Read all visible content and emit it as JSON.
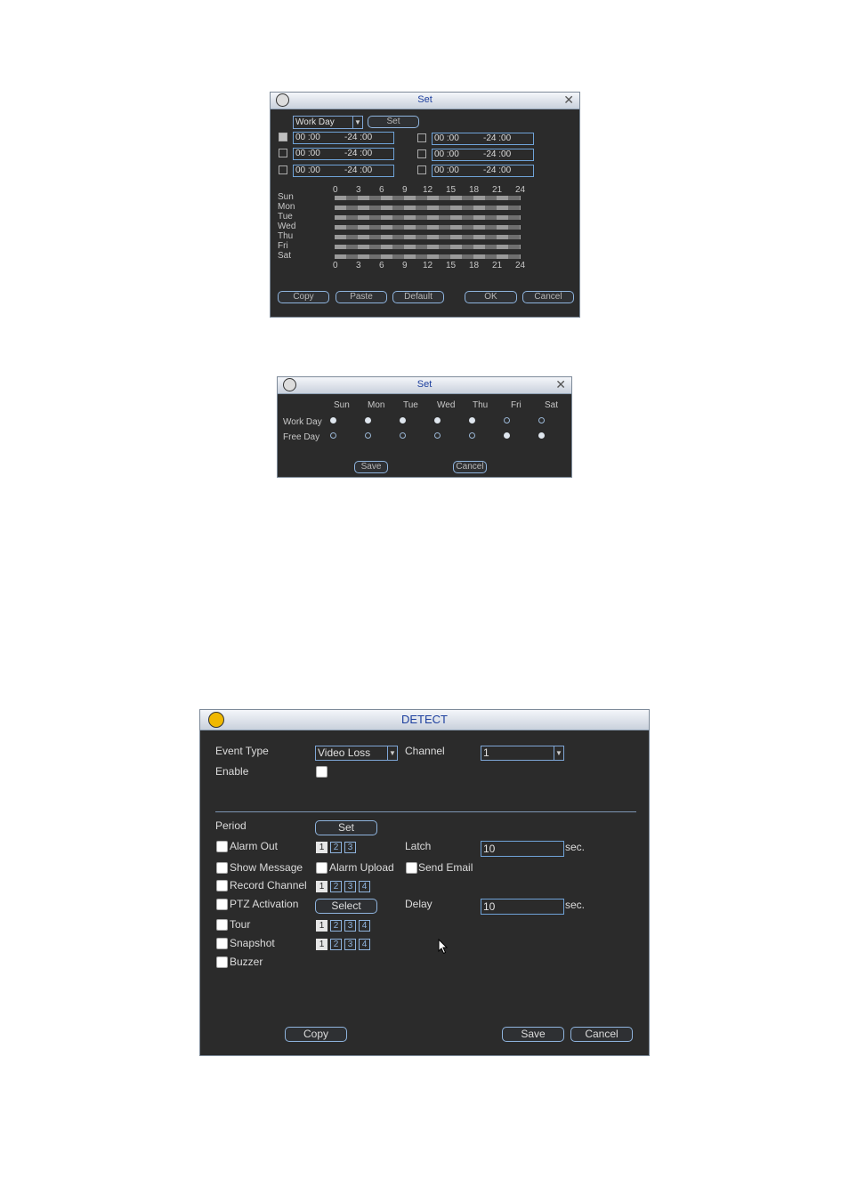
{
  "set_window": {
    "title": "Set",
    "dropdown_value": "Work Day",
    "set_button": "Set",
    "periods_left": [
      {
        "start": "00 :00",
        "end": "-24 :00",
        "checked": true
      },
      {
        "start": "00 :00",
        "end": "-24 :00",
        "checked": false
      },
      {
        "start": "00 :00",
        "end": "-24 :00",
        "checked": false
      }
    ],
    "periods_right": [
      {
        "start": "00 :00",
        "end": "-24 :00",
        "checked": false
      },
      {
        "start": "00 :00",
        "end": "-24 :00",
        "checked": false
      },
      {
        "start": "00 :00",
        "end": "-24 :00",
        "checked": false
      }
    ],
    "days": [
      "Sun",
      "Mon",
      "Tue",
      "Wed",
      "Thu",
      "Fri",
      "Sat"
    ],
    "hours": [
      "0",
      "3",
      "6",
      "9",
      "12",
      "15",
      "18",
      "21",
      "24"
    ],
    "buttons": {
      "copy": "Copy",
      "paste": "Paste",
      "default": "Default",
      "ok": "OK",
      "cancel": "Cancel"
    }
  },
  "day_window": {
    "title": "Set",
    "days": [
      "Sun",
      "Mon",
      "Tue",
      "Wed",
      "Thu",
      "Fri",
      "Sat"
    ],
    "row_work": "Work Day",
    "row_free": "Free Day",
    "work_selected": [
      true,
      true,
      true,
      true,
      true,
      false,
      false
    ],
    "save": "Save",
    "cancel": "Cancel"
  },
  "detect": {
    "title": "DETECT",
    "event_type_label": "Event Type",
    "event_type_value": "Video Loss",
    "channel_label": "Channel",
    "channel_value": "1",
    "enable_label": "Enable",
    "period_label": "Period",
    "period_button": "Set",
    "alarm_out": "Alarm Out",
    "alarm_out_channels": [
      "1",
      "2",
      "3"
    ],
    "latch_label": "Latch",
    "latch_value": "10",
    "latch_unit": "sec.",
    "show_message": "Show Message",
    "alarm_upload": "Alarm Upload",
    "send_email": "Send Email",
    "record_channel": "Record Channel",
    "record_channels": [
      "1",
      "2",
      "3",
      "4"
    ],
    "ptz_activation": "PTZ Activation",
    "ptz_button": "Select",
    "delay_label": "Delay",
    "delay_value": "10",
    "delay_unit": "sec.",
    "tour": "Tour",
    "tour_channels": [
      "1",
      "2",
      "3",
      "4"
    ],
    "snapshot": "Snapshot",
    "snapshot_channels": [
      "1",
      "2",
      "3",
      "4"
    ],
    "buzzer": "Buzzer",
    "copy": "Copy",
    "save": "Save",
    "cancel": "Cancel"
  }
}
